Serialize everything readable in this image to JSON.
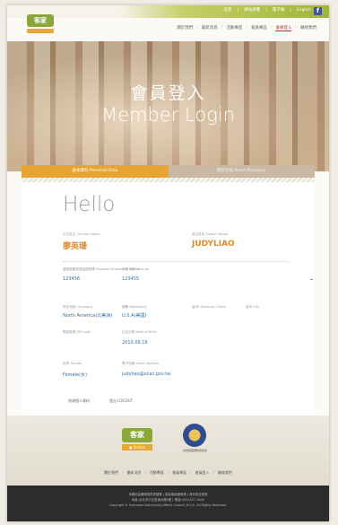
{
  "topbar": {
    "links": [
      "首頁",
      "網站導覽",
      "電子報",
      "English"
    ],
    "facebook_icon": "facebook-icon",
    "extra": "RSS"
  },
  "logo": {
    "mark_text": "客家",
    "sub_text": ""
  },
  "mainnav": {
    "items": [
      "關於我們",
      "最新消息",
      "活動專區",
      "會員專區",
      "會員登入",
      "聯絡我們"
    ],
    "active_index": 4
  },
  "hero": {
    "title_zh": "會員登入",
    "title_en": "Member Login"
  },
  "tabs": {
    "active": "基本資料 Personal Data",
    "inactive": "變更密碼 Reset Password"
  },
  "profile": {
    "greeting": "Hello",
    "chinese_name": {
      "label": "中文姓名 Chinese Name",
      "value": "廖英珊"
    },
    "english_name": {
      "label": "英文姓名 English Name",
      "value": "JUDYLIAO"
    },
    "passport": {
      "label": "護照號碼或居留證號碼 Passport Number or others",
      "value": "123456"
    },
    "card_no": {
      "label": "會員卡號 Card No",
      "value": "123455"
    },
    "continent": {
      "label": "所在洲別 Continent",
      "value": "North America(北美洲)"
    },
    "nationality": {
      "label": "國籍 Nationality",
      "value": "U.S.A(美國)"
    },
    "province": {
      "label": "省/州 Province / State",
      "value": ""
    },
    "city": {
      "label": "城市 City",
      "value": ""
    },
    "zip": {
      "label": "郵遞區號 ZIP code",
      "value": ""
    },
    "birth": {
      "label": "出生日期 Date of Birth",
      "value": "2010.09.16"
    },
    "gender": {
      "label": "性別 Gender",
      "value": "Female(女)"
    },
    "email": {
      "label": "電子信箱 Email Address",
      "value": "judyliao@ocac.gov.tw"
    }
  },
  "actions": {
    "edit": "修改個人資料",
    "logout": "登出 LOGOUT"
  },
  "footer": {
    "logo_mark": "客家",
    "logo_sub": "● Online",
    "emblem_caption": "中華民國僑務委員會",
    "nav": [
      "關於我們",
      "最新消息",
      "活動專區",
      "會員專區",
      "會員登入",
      "聯絡我們"
    ]
  },
  "copyright": {
    "lines": [
      "本網站由僑務委員會建置 | 隱私權保護政策 | 資訊安全政策",
      "地址:台北市中正區徐州路5號 | 電話:(02)2327-2600",
      "Copyright © Overseas Community Affairs Council, R.O.C. All Rights Reserved."
    ]
  }
}
